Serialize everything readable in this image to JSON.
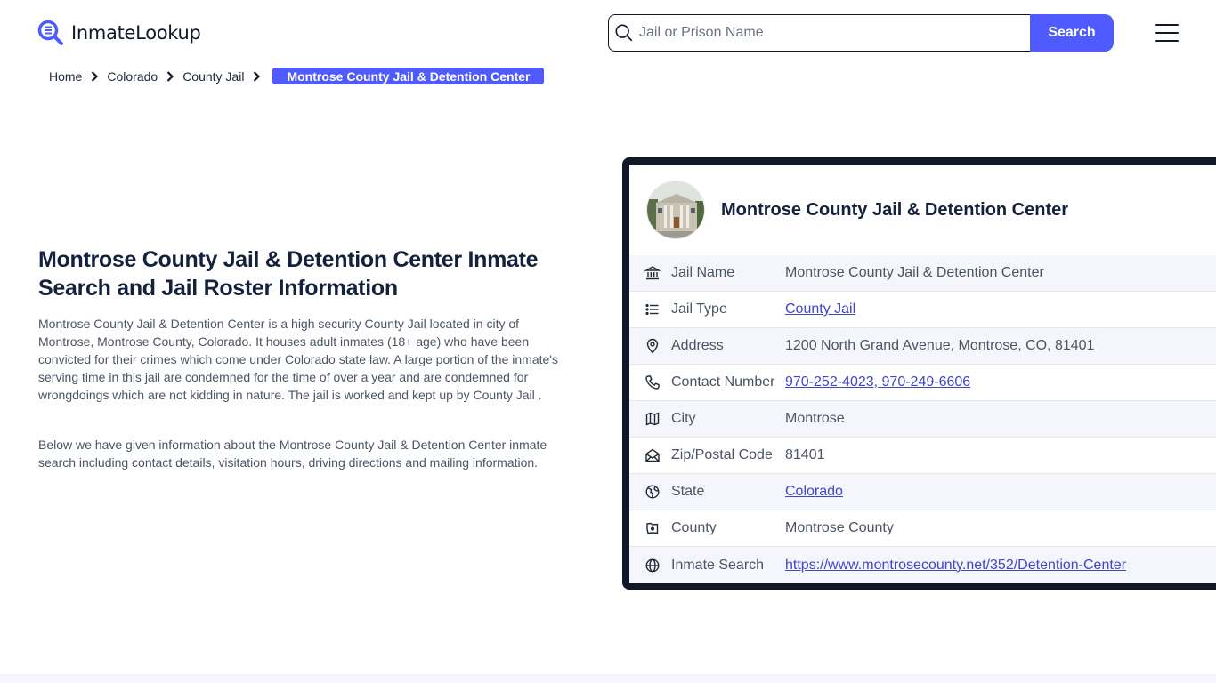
{
  "header": {
    "logo_text": "InmateLookup",
    "search": {
      "placeholder": "Jail or Prison Name",
      "value": "",
      "button_label": "Search"
    },
    "brand_color": "#4f5bff"
  },
  "breadcrumb": {
    "items": [
      "Home",
      "Colorado",
      "County Jail"
    ],
    "current": "Montrose County Jail & Detention Center"
  },
  "main": {
    "title": "Montrose County Jail & Detention Center Inmate Search and Jail Roster Information",
    "paragraphs": [
      "Montrose County Jail & Detention Center is a high security County Jail located in city of Montrose, Montrose County, Colorado. It houses adult inmates (18+ age) who have been convicted for their crimes which come under Colorado state law. A large portion of the inmate's serving time in this jail are condemned for the time of over a year and are condemned for wrongdoings which are not kidding in nature. The jail is worked and kept up by County Jail .",
      "Below we have given information about the Montrose County Jail & Detention Center inmate search including contact details, visitation hours, driving directions and mailing information."
    ]
  },
  "card": {
    "title": "Montrose County Jail & Detention Center",
    "rows": [
      {
        "icon": "bank-icon",
        "label": "Jail Name",
        "value": "Montrose County Jail & Detention Center",
        "link": false
      },
      {
        "icon": "list-icon",
        "label": "Jail Type",
        "value": "County Jail",
        "link": true
      },
      {
        "icon": "map-pin-icon",
        "label": "Address",
        "value": "1200 North Grand Avenue, Montrose, CO, 81401",
        "link": false
      },
      {
        "icon": "phone-icon",
        "label": "Contact Number",
        "value": "970-252-4023, 970-249-6606",
        "link": true
      },
      {
        "icon": "map-icon",
        "label": "City",
        "value": "Montrose",
        "link": false
      },
      {
        "icon": "mail-open-icon",
        "label": "Zip/Postal Code",
        "value": "81401",
        "link": false
      },
      {
        "icon": "state-globe-icon",
        "label": "State",
        "value": "Colorado",
        "link": true
      },
      {
        "icon": "county-map-icon",
        "label": "County",
        "value": "Montrose County",
        "link": false
      },
      {
        "icon": "globe-icon",
        "label": "Inmate Search",
        "value": "https://www.montrosecounty.net/352/Detention-Center",
        "link": true
      }
    ]
  }
}
